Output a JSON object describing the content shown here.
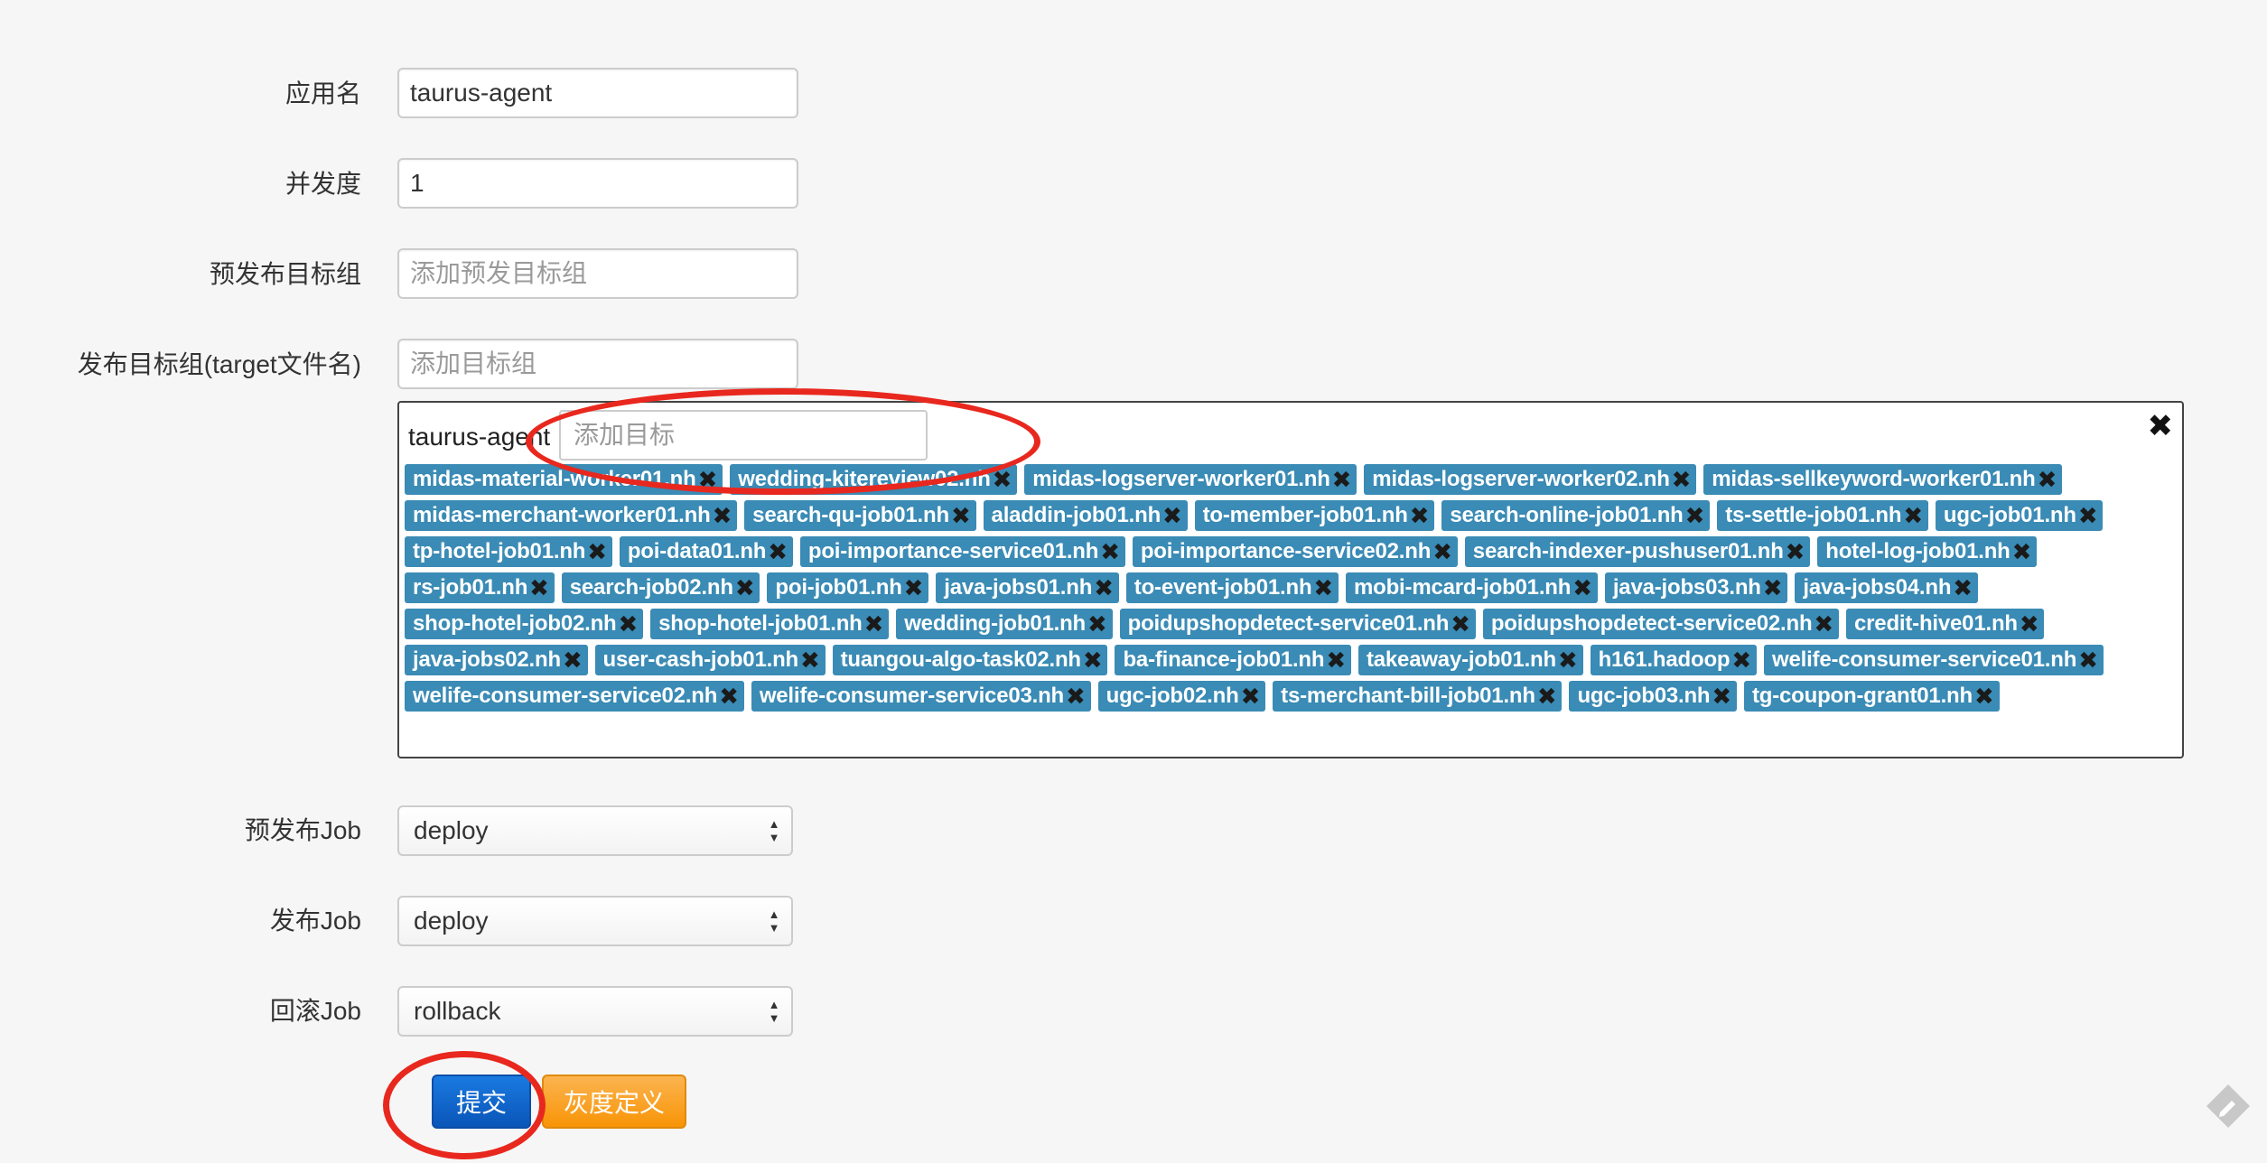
{
  "labels": {
    "app_name": "应用名",
    "concurrency": "并发度",
    "pre_target_group": "预发布目标组",
    "target_group": "发布目标组(target文件名)",
    "pre_job": "预发布Job",
    "job": "发布Job",
    "rollback_job": "回滚Job"
  },
  "inputs": {
    "app_name": "taurus-agent",
    "concurrency": "1",
    "pre_target_group_placeholder": "添加预发目标组",
    "target_group_placeholder": "添加目标组"
  },
  "panel": {
    "group_name": "taurus-agent",
    "target_placeholder": "添加目标",
    "close_glyph": "✖",
    "remove_glyph": "✖",
    "tags": [
      "midas-material-worker01.nh",
      "wedding-kitereview02.nh",
      "midas-logserver-worker01.nh",
      "midas-logserver-worker02.nh",
      "midas-sellkeyword-worker01.nh",
      "midas-merchant-worker01.nh",
      "search-qu-job01.nh",
      "aladdin-job01.nh",
      "to-member-job01.nh",
      "search-online-job01.nh",
      "ts-settle-job01.nh",
      "ugc-job01.nh",
      "tp-hotel-job01.nh",
      "poi-data01.nh",
      "poi-importance-service01.nh",
      "poi-importance-service02.nh",
      "search-indexer-pushuser01.nh",
      "hotel-log-job01.nh",
      "rs-job01.nh",
      "search-job02.nh",
      "poi-job01.nh",
      "java-jobs01.nh",
      "to-event-job01.nh",
      "mobi-mcard-job01.nh",
      "java-jobs03.nh",
      "java-jobs04.nh",
      "shop-hotel-job02.nh",
      "shop-hotel-job01.nh",
      "wedding-job01.nh",
      "poidupshopdetect-service01.nh",
      "poidupshopdetect-service02.nh",
      "credit-hive01.nh",
      "java-jobs02.nh",
      "user-cash-job01.nh",
      "tuangou-algo-task02.nh",
      "ba-finance-job01.nh",
      "takeaway-job01.nh",
      "h161.hadoop",
      "welife-consumer-service01.nh",
      "welife-consumer-service02.nh",
      "welife-consumer-service03.nh",
      "ugc-job02.nh",
      "ts-merchant-bill-job01.nh",
      "ugc-job03.nh",
      "tg-coupon-grant01.nh"
    ]
  },
  "selects": {
    "pre_job": "deploy",
    "job": "deploy",
    "rollback_job": "rollback"
  },
  "buttons": {
    "submit": "提交",
    "gray_define": "灰度定义"
  },
  "colors": {
    "tag_bg": "#3a8bb5",
    "primary": "#0a55b8",
    "warning": "#f89406",
    "annotation": "#e8281e"
  }
}
